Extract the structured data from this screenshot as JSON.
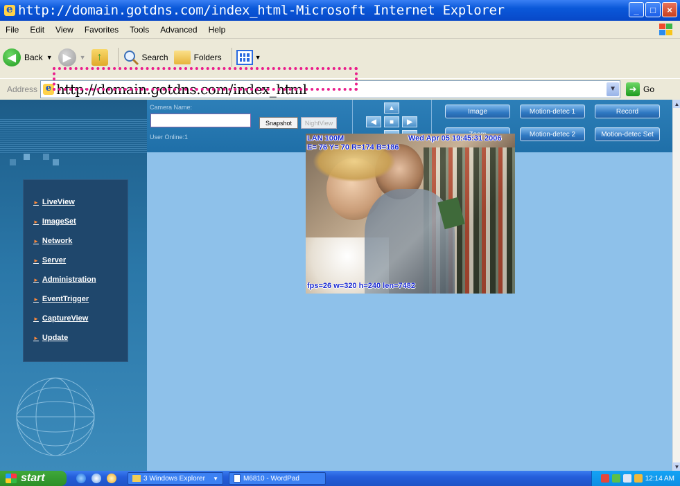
{
  "window": {
    "title": "http://domain.gotdns.com/index_html-Microsoft Internet Explorer"
  },
  "menu": [
    "File",
    "Edit",
    "View",
    "Favorites",
    "Tools",
    "Advanced",
    "Help"
  ],
  "toolbar": {
    "back": "Back",
    "search": "Search",
    "folders": "Folders"
  },
  "address": {
    "label": "Address",
    "url": "http://domain.gotdns.com/index_html",
    "go": "Go"
  },
  "camera_panel": {
    "camera_name_label": "Camera Name:",
    "camera_name_value": "",
    "snapshot": "Snapshot",
    "nightview": "NightView",
    "user_online": "User Online:1"
  },
  "function_buttons": [
    "Image",
    "Motion-detec 1",
    "Record",
    "Zoom",
    "Motion-detec 2",
    "Motion-detec Set"
  ],
  "nav": [
    "LiveView",
    "ImageSet",
    "Network",
    "Server",
    "Administration",
    "EventTrigger",
    "CaptureView",
    "Update"
  ],
  "video_overlay": {
    "top_left": "LAN 100M",
    "top_right": "Wed Apr 05 19:45:31 2006",
    "second_line": "E= 76 Y= 70 R=174 B=186",
    "bottom": "fps=26 w=320 h=240 len=7482"
  },
  "taskbar": {
    "start": "start",
    "tasks": [
      "3 Windows Explorer",
      "M6810 - WordPad"
    ],
    "clock": "12:14 AM"
  },
  "colors": {
    "highlight": "#ea1e8c",
    "content_bg": "#8ec1ea",
    "sidebar": "#1d5c88"
  }
}
